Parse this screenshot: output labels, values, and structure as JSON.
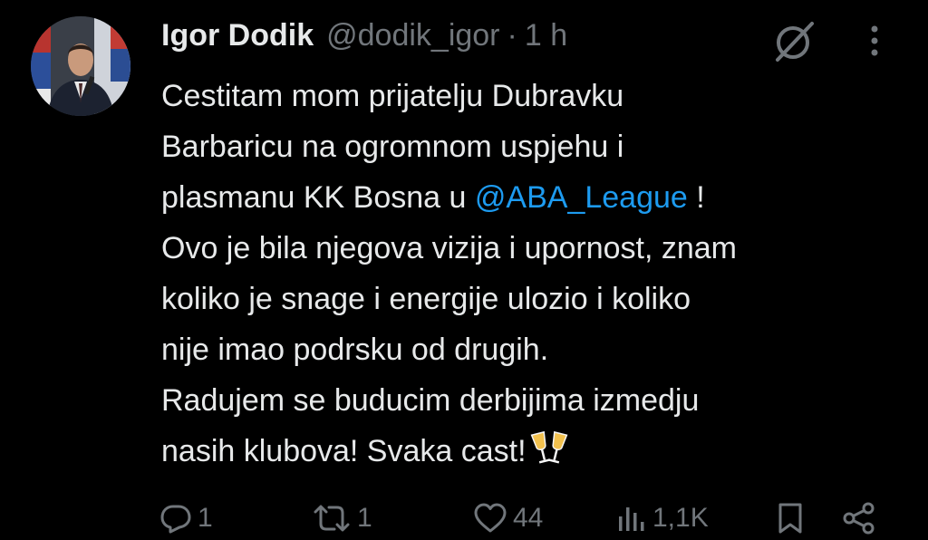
{
  "tweet": {
    "author": {
      "display_name": "Igor Dodik",
      "handle": "@dodik_igor",
      "separator": "·",
      "time": "1 h"
    },
    "text": {
      "line1": "Cestitam mom prijatelju Dubravku",
      "line2": "Barbaricu na ogromnom uspjehu i",
      "line3_before": "plasmanu KK Bosna u ",
      "line3_mention": "@ABA_League",
      "line3_after": " !",
      "line4": "Ovo je bila njegova vizija i upornost, znam",
      "line5": "koliko je snage i energije ulozio i koliko",
      "line6": "nije imao podrsku od drugih.",
      "line7": "Radujem se buducim derbijima izmedju",
      "line8": "nasih klubova! Svaka cast!",
      "emoji": "🥂"
    },
    "metrics": {
      "replies": "1",
      "reposts": "1",
      "likes": "44",
      "views": "1,1K"
    },
    "icons": {
      "avatar": "profile-photo",
      "grok": "grok-icon",
      "more": "more-vertical-icon",
      "reply": "reply-icon",
      "repost": "repost-icon",
      "like": "heart-icon",
      "views": "views-icon",
      "bookmark": "bookmark-icon",
      "share": "share-icon"
    },
    "colors": {
      "background": "#000000",
      "text": "#e7e9ea",
      "secondary": "#71767b",
      "link": "#1d9bf0"
    }
  }
}
